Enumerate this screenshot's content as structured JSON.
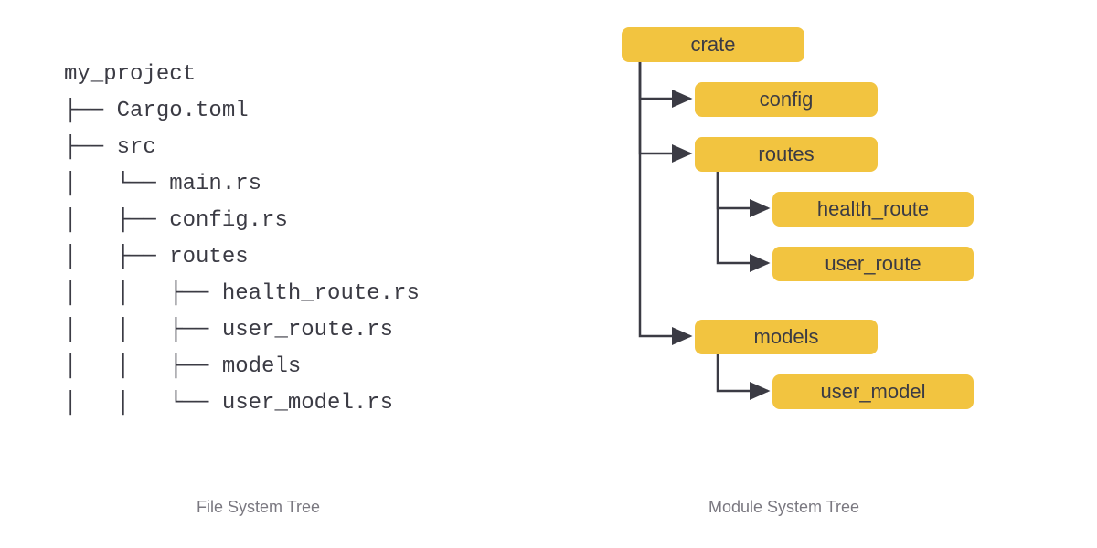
{
  "captions": {
    "left": "File System Tree",
    "right": "Module System Tree"
  },
  "filesystem": {
    "root": "my_project",
    "lines": [
      "my_project",
      "├── Cargo.toml",
      "├── src",
      "│   └── main.rs",
      "│   ├── config.rs",
      "│   ├── routes",
      "│   │   ├── health_route.rs",
      "│   │   ├── user_route.rs",
      "│   │   ├── models",
      "│   │   └── user_model.rs"
    ],
    "entries": [
      {
        "name": "my_project",
        "type": "dir",
        "depth": 0
      },
      {
        "name": "Cargo.toml",
        "type": "file",
        "depth": 1
      },
      {
        "name": "src",
        "type": "dir",
        "depth": 1
      },
      {
        "name": "main.rs",
        "type": "file",
        "depth": 2
      },
      {
        "name": "config.rs",
        "type": "file",
        "depth": 2
      },
      {
        "name": "routes",
        "type": "dir",
        "depth": 2
      },
      {
        "name": "health_route.rs",
        "type": "file",
        "depth": 3
      },
      {
        "name": "user_route.rs",
        "type": "file",
        "depth": 3
      },
      {
        "name": "models",
        "type": "dir",
        "depth": 2
      },
      {
        "name": "user_model.rs",
        "type": "file",
        "depth": 3
      }
    ]
  },
  "modules": {
    "root": "crate",
    "nodes": {
      "crate": "crate",
      "config": "config",
      "routes": "routes",
      "health_route": "health_route",
      "user_route": "user_route",
      "models": "models",
      "user_model": "user_model"
    },
    "tree": {
      "name": "crate",
      "children": [
        {
          "name": "config"
        },
        {
          "name": "routes",
          "children": [
            {
              "name": "health_route"
            },
            {
              "name": "user_route"
            }
          ]
        },
        {
          "name": "models",
          "children": [
            {
              "name": "user_model"
            }
          ]
        }
      ]
    }
  },
  "colors": {
    "node_bg": "#f2c440",
    "text": "#3b3b44",
    "caption": "#7a7880"
  }
}
